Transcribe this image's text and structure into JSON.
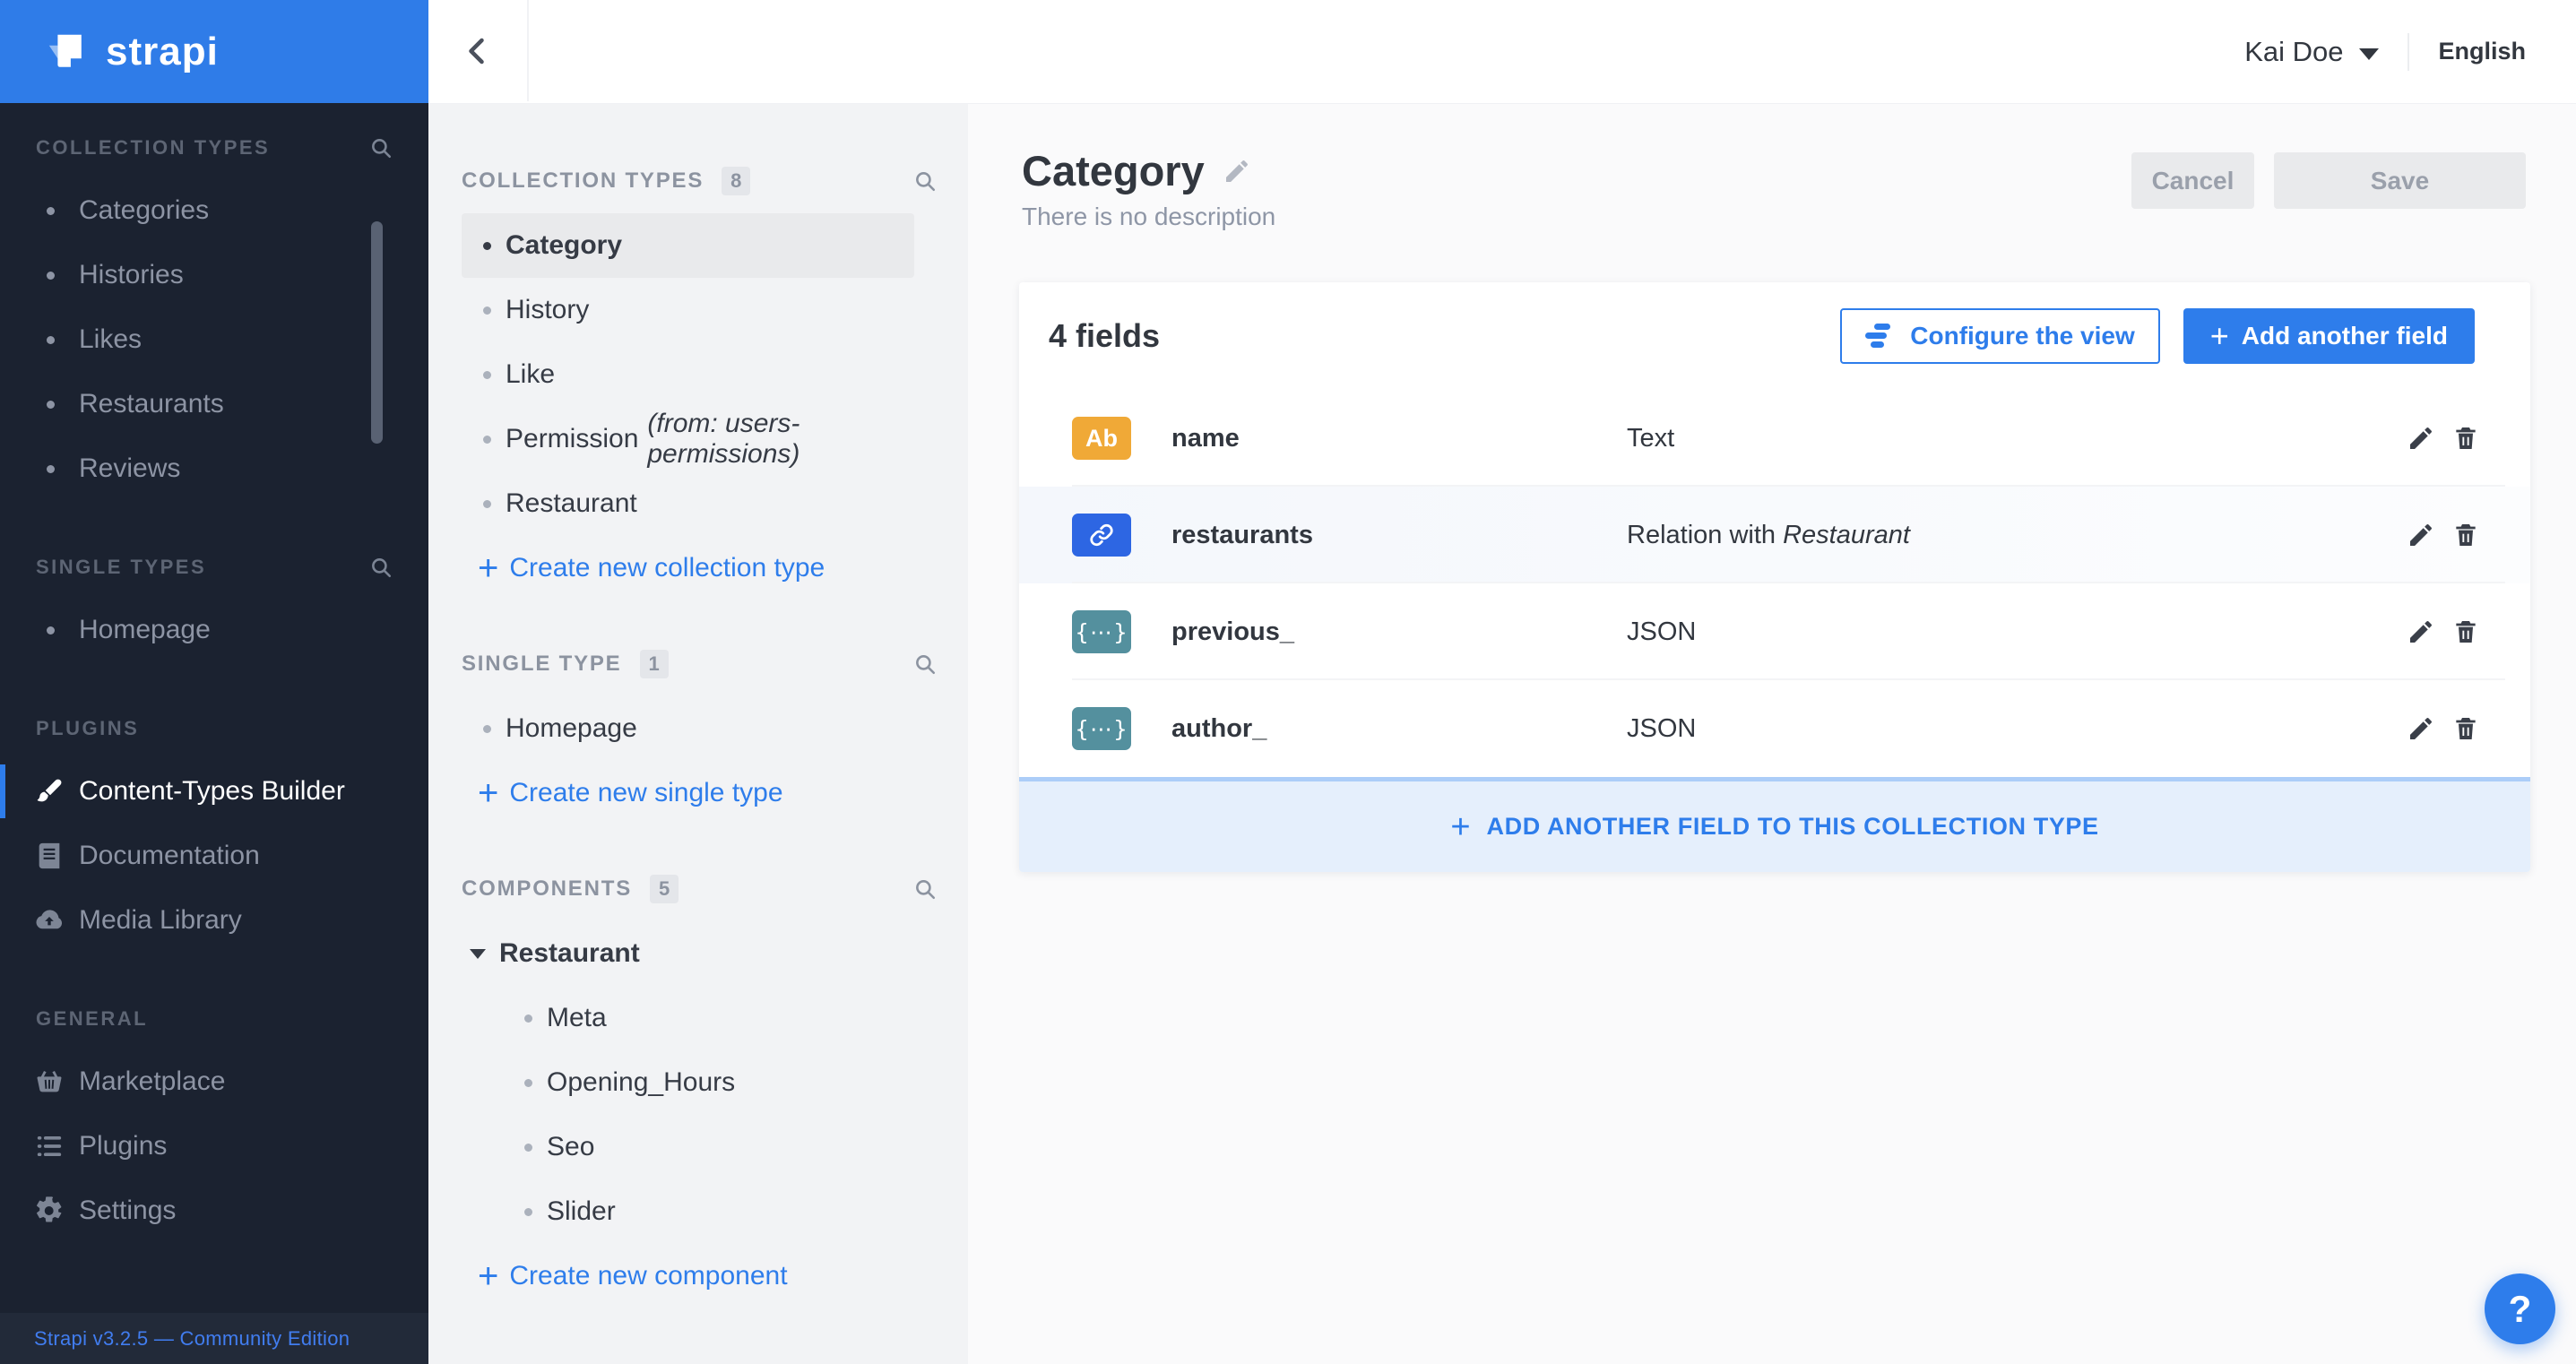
{
  "brand": {
    "name": "strapi"
  },
  "colors": {
    "brand_blue": "#2f7ce8",
    "accent": "#2e7deb",
    "field_text_badge": "#f0a937",
    "field_relation": "#2d66e3",
    "field_json": "#54909e"
  },
  "topbar": {
    "user": "Kai Doe",
    "locale": "English"
  },
  "left_sidebar": {
    "sections": [
      {
        "title": "COLLECTION TYPES",
        "search": true,
        "items": [
          {
            "label": "Categories"
          },
          {
            "label": "Histories"
          },
          {
            "label": "Likes"
          },
          {
            "label": "Restaurants"
          },
          {
            "label": "Reviews"
          }
        ]
      },
      {
        "title": "SINGLE TYPES",
        "search": true,
        "items": [
          {
            "label": "Homepage"
          }
        ]
      },
      {
        "title": "PLUGINS",
        "items": [
          {
            "label": "Content-Types Builder",
            "icon": "brush",
            "active": true
          },
          {
            "label": "Documentation",
            "icon": "book"
          },
          {
            "label": "Media Library",
            "icon": "cloud-upload"
          }
        ]
      },
      {
        "title": "GENERAL",
        "items": [
          {
            "label": "Marketplace",
            "icon": "basket"
          },
          {
            "label": "Plugins",
            "icon": "list"
          },
          {
            "label": "Settings",
            "icon": "gear"
          }
        ]
      }
    ],
    "footer": "Strapi v3.2.5 — Community Edition"
  },
  "subnav": {
    "sections": [
      {
        "title": "COLLECTION TYPES",
        "count": "8",
        "search": true,
        "items": [
          {
            "label": "Category",
            "active": true
          },
          {
            "label": "History"
          },
          {
            "label": "Like"
          },
          {
            "label": "Permission",
            "note": "(from: users-permissions)"
          },
          {
            "label": "Restaurant"
          }
        ],
        "action": "Create new collection type"
      },
      {
        "title": "SINGLE TYPE",
        "count": "1",
        "search": true,
        "items": [
          {
            "label": "Homepage"
          }
        ],
        "action": "Create new single type"
      },
      {
        "title": "COMPONENTS",
        "count": "5",
        "search": true,
        "items": [
          {
            "label": "Restaurant",
            "expanded": true
          },
          {
            "label": "Meta",
            "child": true
          },
          {
            "label": "Opening_Hours",
            "child": true
          },
          {
            "label": "Seo",
            "child": true
          },
          {
            "label": "Slider",
            "child": true
          }
        ],
        "action": "Create new component"
      }
    ]
  },
  "page": {
    "title": "Category",
    "subtitle": "There is no description",
    "cancel_label": "Cancel",
    "save_label": "Save"
  },
  "fields_panel": {
    "heading": "4 fields",
    "configure_label": "Configure the view",
    "add_label": "Add another field",
    "rows": [
      {
        "icon": "text",
        "badge": "Ab",
        "name": "name",
        "type": "Text"
      },
      {
        "icon": "relation",
        "name": "restaurants",
        "type": "Relation with ",
        "type_em": "Restaurant",
        "tinted": true
      },
      {
        "icon": "json",
        "badge": "{⋯}",
        "name": "previous_",
        "type": "JSON"
      },
      {
        "icon": "json",
        "badge": "{⋯}",
        "name": "author_",
        "type": "JSON"
      }
    ],
    "footer_label": "ADD ANOTHER FIELD TO THIS COLLECTION TYPE"
  },
  "help_label": "?"
}
